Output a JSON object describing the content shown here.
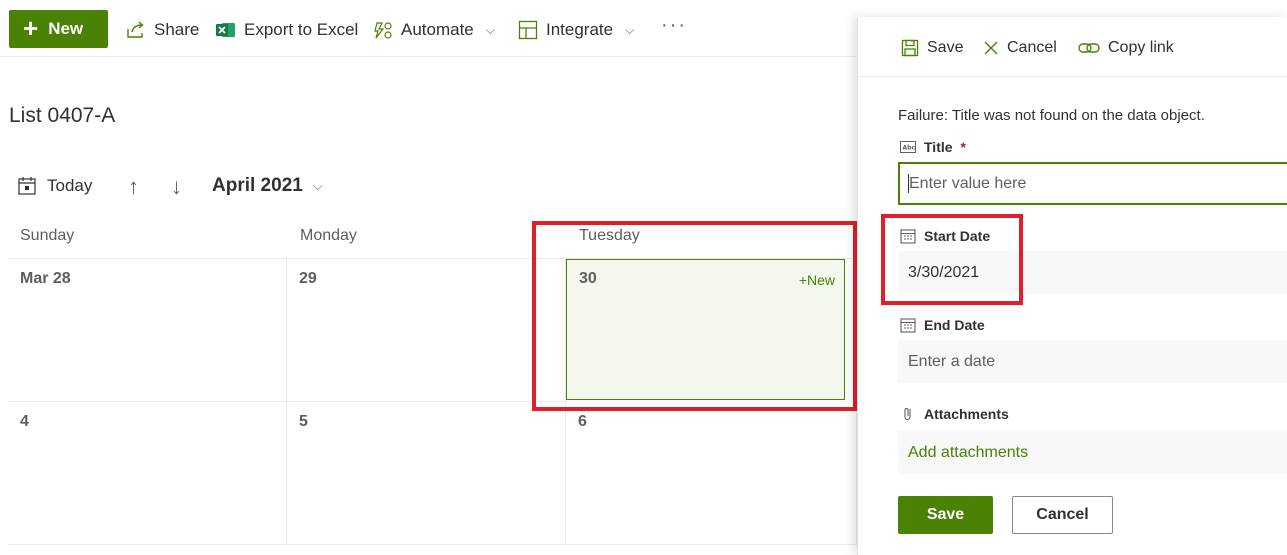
{
  "command_bar": {
    "new_label": "New",
    "share_label": "Share",
    "export_label": "Export to Excel",
    "automate_label": "Automate",
    "integrate_label": "Integrate",
    "more_label": "···"
  },
  "list_title": "List 0407-A",
  "calendar_nav": {
    "today_label": "Today",
    "month_label": "April 2021"
  },
  "calendar": {
    "day_headers": [
      "Sunday",
      "Monday",
      "Tuesday"
    ],
    "week1": [
      "Mar 28",
      "29",
      "30"
    ],
    "week2": [
      "4",
      "5",
      "6"
    ],
    "new_link": "+New"
  },
  "panel": {
    "save_label": "Save",
    "cancel_label": "Cancel",
    "copy_link_label": "Copy link",
    "error_message": "Failure: Title was not found on the data object.",
    "fields": {
      "title_label": "Title",
      "title_required": "*",
      "title_placeholder": "Enter value here",
      "start_date_label": "Start Date",
      "start_date_value": "3/30/2021",
      "end_date_label": "End Date",
      "end_date_placeholder": "Enter a date",
      "attachments_label": "Attachments",
      "attachments_link": "Add attachments"
    },
    "footer": {
      "save_button": "Save",
      "cancel_button": "Cancel"
    }
  },
  "colors": {
    "accent": "#498205",
    "highlight_box": "#e01f2a",
    "selected_cell_bg": "#f3f7ee"
  }
}
